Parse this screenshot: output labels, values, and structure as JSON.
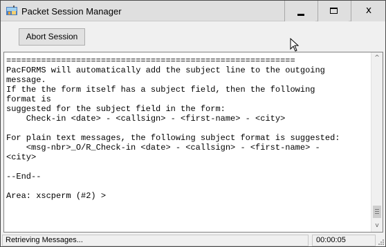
{
  "window": {
    "title": "Packet Session Manager",
    "icon": "packet-app-icon",
    "controls": {
      "minimize": "minimize-icon",
      "maximize": "maximize-icon",
      "close_glyph": "x"
    }
  },
  "toolbar": {
    "abort_label": "Abort Session"
  },
  "console": {
    "text": "==========================================================\nPacFORMS will automatically add the subject line to the outgoing\nmessage.\nIf the the form itself has a subject field, then the following\nformat is\nsuggested for the subject field in the form:\n    Check-in <date> - <callsign> - <first-name> - <city>\n\nFor plain text messages, the following subject format is suggested:\n    <msg-nbr>_O/R_Check-in <date> - <callsign> - <first-name> -\n<city>\n\n--End--\n\nArea: xscperm (#2) >",
    "scroll_up": "^",
    "scroll_down": "v"
  },
  "status": {
    "message": "Retrieving Messages...",
    "elapsed": "00:00:05"
  },
  "colors": {
    "titlebar": "#dfdfdf",
    "window_bg": "#f0f0f0",
    "console_bg": "#ffffff"
  }
}
